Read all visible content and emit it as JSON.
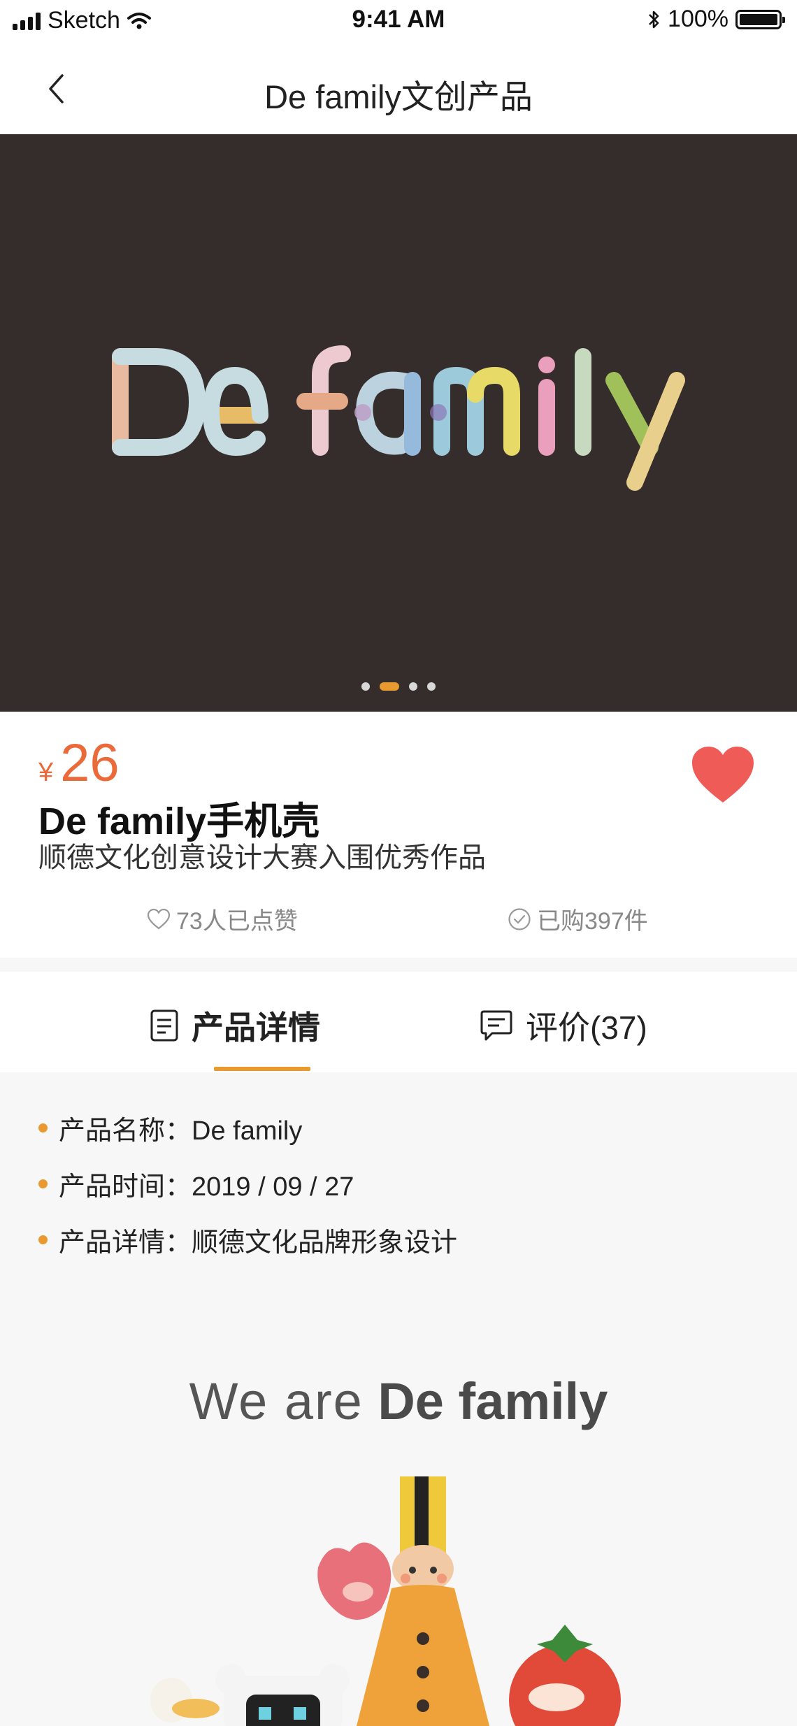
{
  "status_bar": {
    "carrier": "Sketch",
    "time": "9:41 AM",
    "battery": "100%"
  },
  "nav": {
    "title": "De family文创产品"
  },
  "hero": {
    "logo_text": "De family",
    "page_count": 4,
    "active_page": 2
  },
  "product": {
    "currency": "¥",
    "price": "26",
    "name": "De family手机壳",
    "subtitle": "顺德文化创意设计大赛入围优秀作品",
    "likes": "73人已点赞",
    "purchases": "已购397件",
    "favorited": true
  },
  "tabs": [
    {
      "label": "产品详情",
      "active": true
    },
    {
      "label": "评价(37)",
      "active": false
    }
  ],
  "details": [
    {
      "text": "产品名称：De family"
    },
    {
      "text": "产品时间：2019 / 09 / 27"
    },
    {
      "text": "产品详情：顺德文化品牌形象设计"
    }
  ],
  "poster": {
    "tagline_light": "We are",
    "tagline_bold": "De family"
  },
  "colors": {
    "accent": "#e89a30",
    "price": "#ea6a3a",
    "heart": "#ef5b57",
    "hero_bg": "#352d2c"
  }
}
